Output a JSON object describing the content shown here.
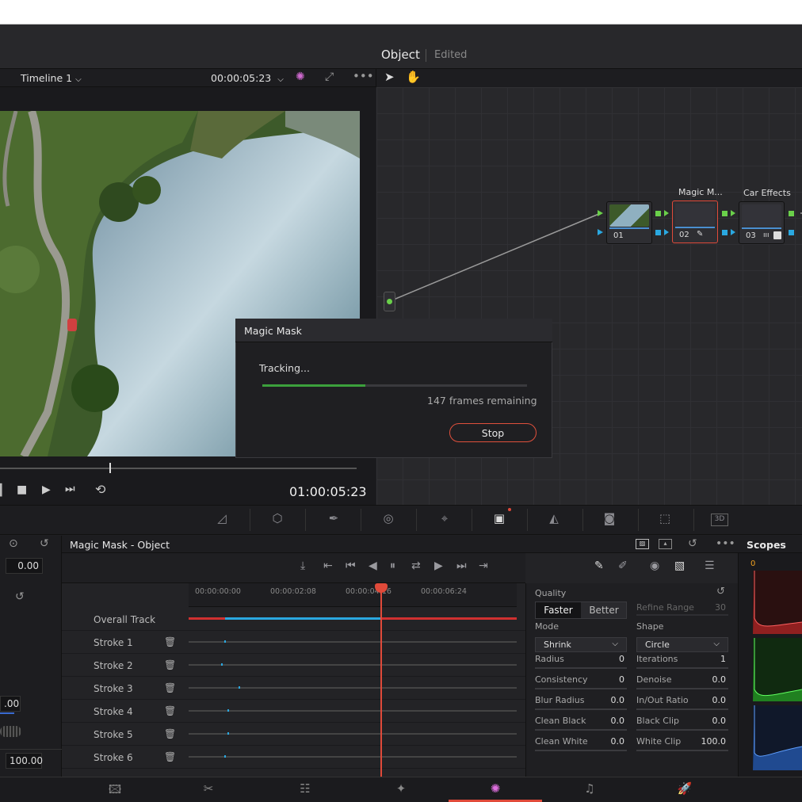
{
  "header": {
    "title": "Object",
    "subtitle": "Edited"
  },
  "viewer": {
    "timeline_name": "Timeline 1",
    "timecode_top": "00:00:05:23",
    "timecode_main": "01:00:05:23"
  },
  "nodes": [
    {
      "number": "01",
      "label": ""
    },
    {
      "number": "02",
      "label": "Magic M..."
    },
    {
      "number": "03",
      "label": "Car Effects"
    }
  ],
  "dialog": {
    "title": "Magic Mask",
    "status": "Tracking...",
    "progress_fraction": 0.39,
    "remaining": "147 frames remaining",
    "stop_label": "Stop"
  },
  "palette_title": "Magic Mask - Object",
  "left_panel": {
    "value1": "0.00",
    "value2": ".00",
    "value3": "100.00"
  },
  "timeline_ruler": [
    "00:00:00:00",
    "00:00:02:08",
    "00:00:04:16",
    "00:00:06:24"
  ],
  "tracks": [
    {
      "name": "Overall Track"
    },
    {
      "name": "Stroke 1"
    },
    {
      "name": "Stroke 2"
    },
    {
      "name": "Stroke 3"
    },
    {
      "name": "Stroke 4"
    },
    {
      "name": "Stroke 5"
    },
    {
      "name": "Stroke 6"
    }
  ],
  "params": {
    "quality_label": "Quality",
    "quality_options": [
      "Faster",
      "Better"
    ],
    "refine_range_label": "Refine Range",
    "refine_range_value": "30",
    "mode_label": "Mode",
    "mode_value": "Shrink",
    "shape_label": "Shape",
    "shape_value": "Circle",
    "left": [
      {
        "label": "Radius",
        "value": "0"
      },
      {
        "label": "Consistency",
        "value": "0"
      },
      {
        "label": "Blur Radius",
        "value": "0.0"
      },
      {
        "label": "Clean Black",
        "value": "0.0"
      },
      {
        "label": "Clean White",
        "value": "0.0"
      }
    ],
    "right": [
      {
        "label": "Iterations",
        "value": "1"
      },
      {
        "label": "Denoise",
        "value": "0.0"
      },
      {
        "label": "In/Out Ratio",
        "value": "0.0"
      },
      {
        "label": "Black Clip",
        "value": "0.0"
      },
      {
        "label": "White Clip",
        "value": "100.0"
      }
    ]
  },
  "scopes": {
    "title": "Scopes",
    "scale_zero": "0"
  },
  "colors": {
    "accent": "#e04a3a",
    "progress": "#3ca03c",
    "node_select": "#e04a3a"
  }
}
